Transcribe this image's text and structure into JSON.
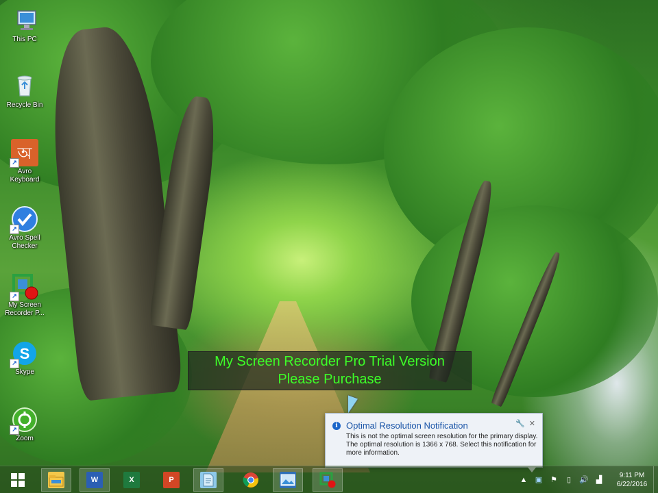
{
  "desktop_icons": [
    {
      "id": "this-pc",
      "label": "This PC",
      "icon": "computer-icon"
    },
    {
      "id": "recycle-bin",
      "label": "Recycle Bin",
      "icon": "recycle-bin-icon"
    },
    {
      "id": "avro-keyboard",
      "label": "Avro Keyboard",
      "icon": "avro-keyboard-icon"
    },
    {
      "id": "avro-spell-checker",
      "label": "Avro Spell Checker",
      "icon": "avro-spell-checker-icon"
    },
    {
      "id": "my-screen-recorder",
      "label": "My Screen Recorder P...",
      "icon": "screen-recorder-icon"
    },
    {
      "id": "skype",
      "label": "Skype",
      "icon": "skype-icon"
    },
    {
      "id": "zoom",
      "label": "Zoom",
      "icon": "zoom-icon"
    }
  ],
  "watermark": {
    "line1": "My Screen Recorder Pro Trial Version",
    "line2": "Please Purchase",
    "color": "#3dff28"
  },
  "notification": {
    "title": "Optimal Resolution Notification",
    "body": "This is not the optimal screen resolution for the primary display. The optimal resolution is 1366 x 768. Select this notification for more information."
  },
  "taskbar": {
    "apps": [
      {
        "id": "start",
        "icon": "windows-start-icon"
      },
      {
        "id": "file-explorer",
        "icon": "file-explorer-icon"
      },
      {
        "id": "word",
        "icon": "word-icon",
        "text": "W"
      },
      {
        "id": "excel",
        "icon": "excel-icon",
        "text": "X"
      },
      {
        "id": "powerpoint",
        "icon": "powerpoint-icon",
        "text": "P"
      },
      {
        "id": "notepad",
        "icon": "notepad-icon"
      },
      {
        "id": "chrome",
        "icon": "chrome-icon"
      },
      {
        "id": "photos",
        "icon": "photos-icon"
      },
      {
        "id": "screen-recorder",
        "icon": "screen-recorder-icon"
      }
    ],
    "clock": {
      "time": "9:11 PM",
      "date": "6/22/2016"
    }
  },
  "colors": {
    "accent_blue": "#1b66c9",
    "notification_title": "#1a55a8"
  }
}
